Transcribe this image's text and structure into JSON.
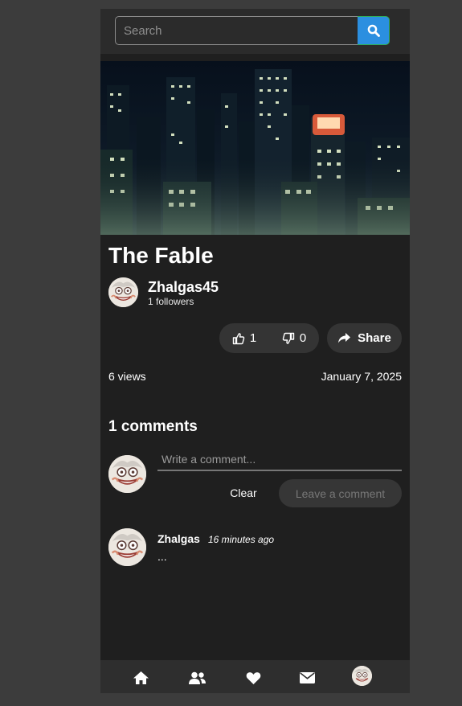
{
  "search": {
    "placeholder": "Search",
    "button_icon": "search-icon",
    "button_color": "#2b8fe0"
  },
  "post": {
    "title": "The Fable",
    "author": {
      "name": "Zhalgas45",
      "followers": "1 followers"
    },
    "likes": "1",
    "dislikes": "0",
    "share_label": "Share",
    "views": "6 views",
    "date": "January 7, 2025"
  },
  "comments": {
    "heading": "1 comments",
    "input_placeholder": "Write a comment...",
    "clear_label": "Clear",
    "submit_label": "Leave a comment",
    "items": [
      {
        "author": "Zhalgas",
        "time": "16 minutes ago",
        "text": "..."
      }
    ]
  },
  "nav": {
    "items": [
      "home-icon",
      "users-icon",
      "heart-icon",
      "envelope-icon",
      "profile-avatar"
    ]
  },
  "colors": {
    "background": "#3c3c3c",
    "surface": "#1f1f1f",
    "pill": "#343434",
    "accent": "#2b8fe0"
  }
}
